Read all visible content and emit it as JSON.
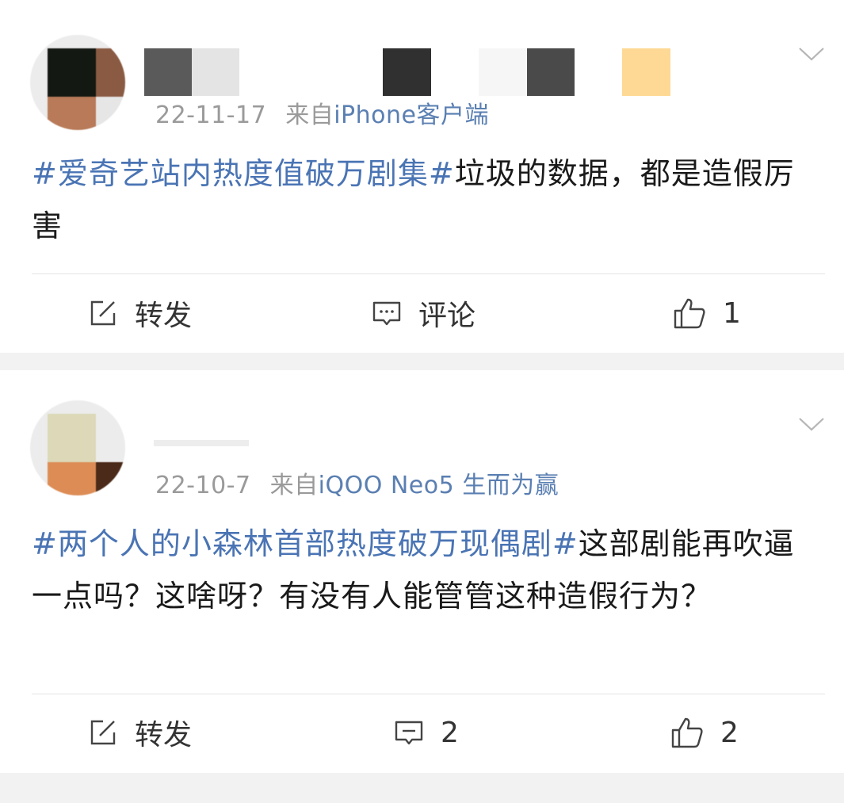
{
  "posts": [
    {
      "date": "22-11-17",
      "from_prefix": "来自",
      "source": "iPhone客户端",
      "topic": "#爱奇艺站内热度值破万剧集#",
      "text": "垃圾的数据，都是造假厉害",
      "actions": {
        "repost": "转发",
        "comment": "评论",
        "like": "1"
      }
    },
    {
      "date": "22-10-7",
      "from_prefix": "来自",
      "source": "iQOO Neo5 生而为赢",
      "topic": "#两个人的小森林首部热度破万现偶剧#",
      "text": "这部剧能再吹逼一点吗？这啥呀？有没有人能管管这种造假行为？",
      "actions": {
        "repost": "转发",
        "comment": "2",
        "like": "2"
      }
    }
  ],
  "colors": {
    "topic": "#4a74b4",
    "source": "#5a7fb2",
    "meta": "#9a9a9a",
    "background": "#f2f2f2"
  },
  "icons": {
    "repost": "edit-square-icon",
    "comment": "comment-bubble-icon",
    "like": "thumbs-up-icon",
    "menu": "chevron-down-icon"
  }
}
